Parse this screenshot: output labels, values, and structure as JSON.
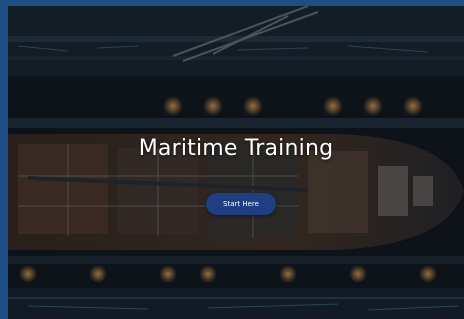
{
  "hero": {
    "title": "Maritime Training",
    "cta_label": "Start Here",
    "background_image": "aerial-view-of-ship-in-shipyard-at-night"
  },
  "colors": {
    "frame": "#1e4e86",
    "button": "#1f3f82",
    "title": "#ffffff"
  }
}
